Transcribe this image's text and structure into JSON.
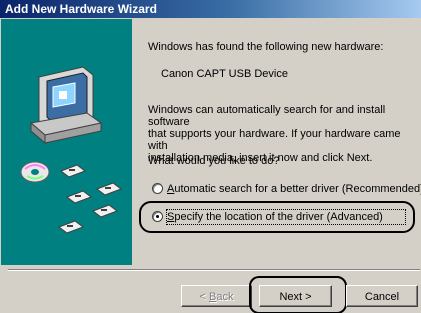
{
  "window": {
    "title": "Add New Hardware Wizard"
  },
  "main": {
    "found_text": "Windows has found the following new hardware:",
    "device_name": "Canon CAPT USB Device",
    "search_text": "Windows can automatically search for and install software\nthat supports your hardware. If your hardware came with\ninstallation media, insert it now and click Next.",
    "question": "What would you like to do?",
    "options": [
      {
        "mnemonic": "A",
        "rest": "utomatic search for a better driver (Recommended)",
        "selected": false
      },
      {
        "mnemonic": "S",
        "rest": "pecify the location of the driver (Advanced)",
        "selected": true
      }
    ]
  },
  "buttons": {
    "back": {
      "prefix": "< ",
      "mnemonic": "B",
      "rest": "ack",
      "enabled": false
    },
    "next": {
      "label": "Next >"
    },
    "cancel": {
      "label": "Cancel"
    }
  }
}
